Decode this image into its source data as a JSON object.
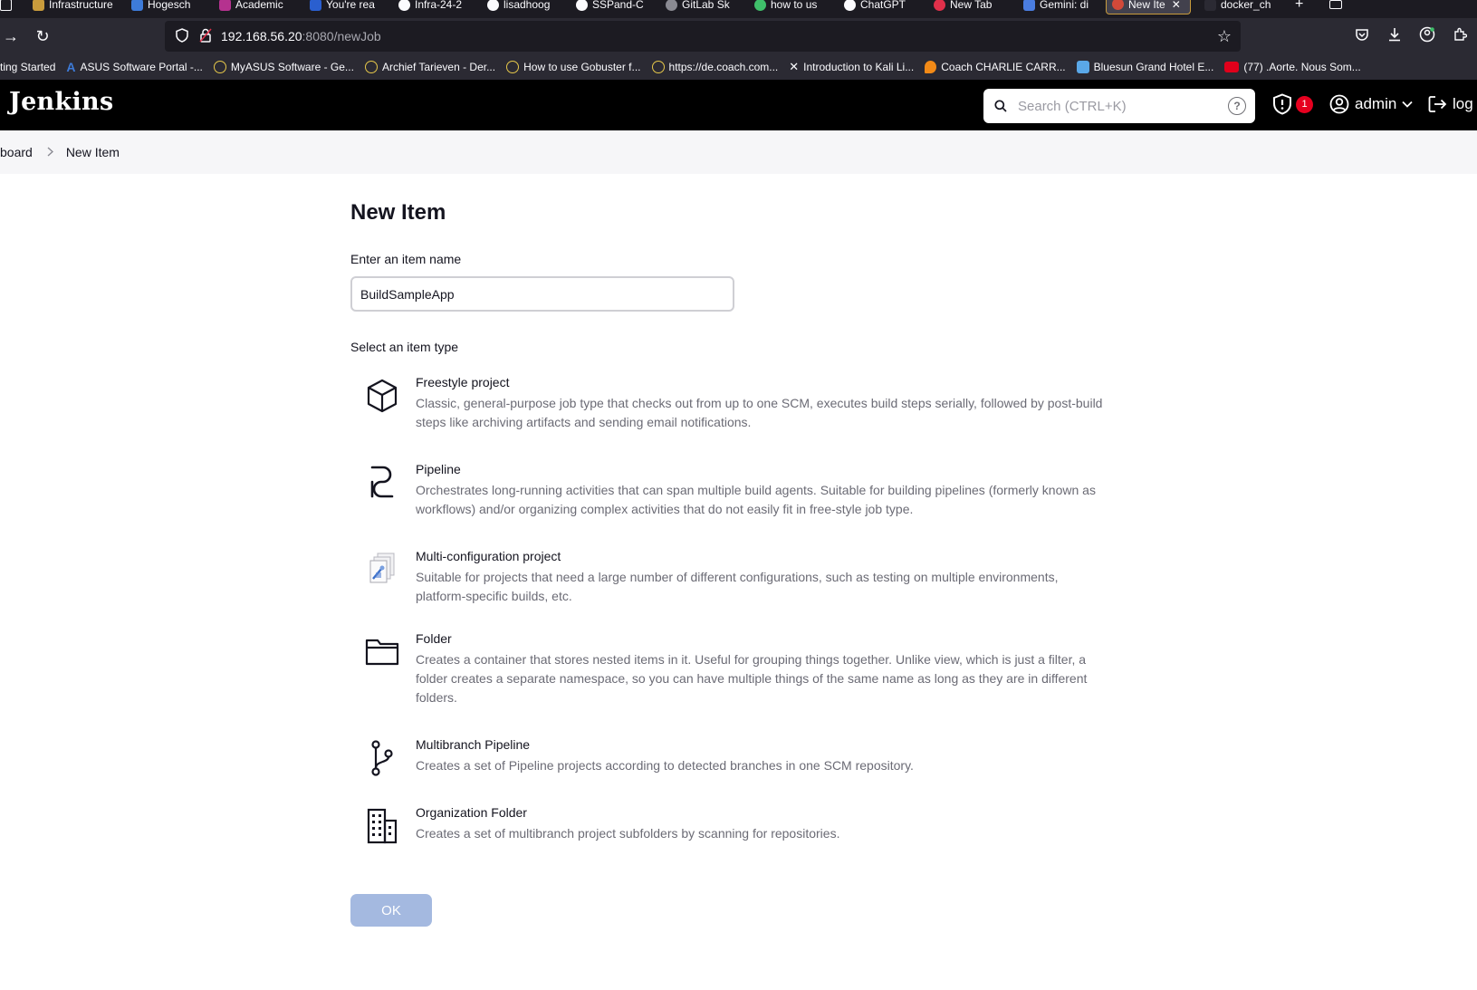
{
  "browser": {
    "tabs": [
      "Infrastructure",
      "Hogesch",
      "Academic",
      "You're rea",
      "Infra-24-2",
      "lisadhoog",
      "SSPand-C",
      "GitLab Sk",
      "how to us",
      "ChatGPT",
      "New Tab",
      "Gemini: di",
      "New Ite",
      "docker_ch"
    ],
    "url_host": "192.168.56.20",
    "url_rest": ":8080/newJob",
    "bookmarks": [
      "ting Started",
      "ASUS Software Portal -...",
      "MyASUS Software - Ge...",
      "Archief Tarieven - Der...",
      "How to use Gobuster f...",
      "https://de.coach.com...",
      "Introduction to Kali Li...",
      "Coach CHARLIE CARR...",
      "Bluesun Grand Hotel E...",
      "(77) .Aorte. Nous Som..."
    ]
  },
  "header": {
    "logo": "Jenkins",
    "search_placeholder": "Search (CTRL+K)",
    "security_count": "1",
    "user": "admin",
    "logout_label": "log"
  },
  "breadcrumb": {
    "items": [
      "board",
      "New Item"
    ]
  },
  "main": {
    "title": "New Item",
    "name_label": "Enter an item name",
    "name_value": "BuildSampleApp",
    "type_label": "Select an item type",
    "item_types": [
      {
        "title": "Freestyle project",
        "desc": "Classic, general-purpose job type that checks out from up to one SCM, executes build steps serially, followed by post-build steps like archiving artifacts and sending email notifications.",
        "icon": "freestyle-cube-icon"
      },
      {
        "title": "Pipeline",
        "desc": "Orchestrates long-running activities that can span multiple build agents. Suitable for building pipelines (formerly known as workflows) and/or organizing complex activities that do not easily fit in free-style job type.",
        "icon": "pipeline-icon"
      },
      {
        "title": "Multi-configuration project",
        "desc": "Suitable for projects that need a large number of different configurations, such as testing on multiple environments, platform-specific builds, etc.",
        "icon": "multi-config-icon"
      },
      {
        "title": "Folder",
        "desc": "Creates a container that stores nested items in it. Useful for grouping things together. Unlike view, which is just a filter, a folder creates a separate namespace, so you can have multiple things of the same name as long as they are in different folders.",
        "icon": "folder-icon"
      },
      {
        "title": "Multibranch Pipeline",
        "desc": "Creates a set of Pipeline projects according to detected branches in one SCM repository.",
        "icon": "branch-icon"
      },
      {
        "title": "Organization Folder",
        "desc": "Creates a set of multibranch project subfolders by scanning for repositories.",
        "icon": "organization-building-icon"
      }
    ],
    "ok_label": "OK"
  },
  "colors": {
    "header_bg": "#000000",
    "breadcrumb_bg": "#f6f6f8",
    "ok_button_disabled": "#a4b9e0",
    "badge_red": "#e6001f"
  }
}
